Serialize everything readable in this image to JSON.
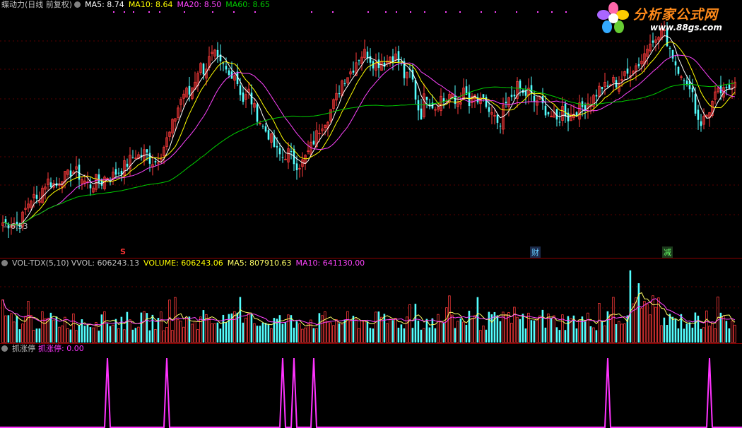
{
  "price_header": {
    "title": "蝶动力(日线 前复权)",
    "ma5": "MA5: 8.74",
    "ma10": "MA10: 8.64",
    "ma20": "MA20: 8.50",
    "ma60": "MA60: 8.65"
  },
  "price_low_label": "6.53",
  "markers": {
    "s": "S",
    "cai": "财",
    "jian": "减"
  },
  "volume_header": {
    "name": "VOL-TDX(5,10)",
    "vvol": "VVOL: 606243.13",
    "volume": "VOLUME: 606243.06",
    "ma5": "MA5: 807910.63",
    "ma10": "MA10: 641130.00"
  },
  "indicator_header": {
    "name": "抓涨停",
    "value": "抓涨停: 0.00"
  },
  "logo": {
    "text": "分析家公式网",
    "url": "www.88gs.com"
  },
  "colors": {
    "up": "#ff3b3b",
    "down": "#54ffff",
    "ma5": "#ffffff",
    "ma10": "#ffff00",
    "ma20": "#ff44ff",
    "ma60": "#00cc00",
    "indicator": "#ff33ff",
    "volume_ma5": "#ffff66",
    "volume_ma10": "#ff44ff"
  },
  "chart_data": {
    "type": "candlestick",
    "ylim": [
      6.4,
      10.6
    ],
    "closes": [
      6.6,
      6.58,
      6.62,
      6.55,
      6.7,
      6.95,
      7.1,
      7.0,
      7.25,
      7.4,
      7.35,
      7.3,
      7.5,
      7.45,
      7.6,
      7.55,
      7.45,
      7.35,
      7.3,
      7.4,
      7.35,
      7.5,
      7.45,
      7.55,
      7.6,
      7.7,
      7.8,
      7.9,
      7.85,
      7.95,
      7.8,
      7.75,
      7.9,
      8.1,
      8.3,
      8.6,
      8.9,
      9.1,
      9.05,
      9.3,
      9.6,
      9.5,
      9.7,
      9.8,
      9.6,
      9.55,
      9.4,
      9.5,
      9.2,
      8.9,
      9.1,
      8.8,
      8.6,
      8.4,
      8.3,
      8.1,
      7.9,
      7.85,
      7.95,
      7.8,
      7.7,
      7.75,
      7.9,
      8.1,
      8.3,
      8.5,
      8.6,
      8.8,
      9.0,
      9.3,
      9.4,
      9.5,
      9.7,
      9.8,
      9.85,
      9.7,
      9.6,
      9.7,
      9.65,
      9.8,
      9.75,
      9.6,
      9.3,
      9.5,
      9.0,
      8.6,
      9.1,
      8.9,
      8.8,
      9.0,
      8.9,
      9.05,
      8.85,
      8.95,
      9.1,
      8.8,
      9.0,
      8.85,
      8.9,
      8.7,
      8.6,
      8.3,
      8.8,
      8.9,
      9.1,
      9.2,
      9.0,
      9.1,
      8.9,
      8.95,
      8.8,
      8.7,
      8.6,
      8.5,
      8.8,
      8.6,
      8.7,
      8.75,
      8.8,
      8.9,
      8.95,
      9.1,
      9.2,
      9.15,
      9.3,
      9.25,
      9.35,
      9.4,
      9.55,
      9.6,
      9.7,
      9.9,
      10.2,
      10.0,
      10.3,
      10.1,
      9.9,
      9.6,
      9.5,
      9.1,
      9.3,
      8.7,
      8.5,
      8.6,
      8.8,
      9.0,
      9.1,
      9.05,
      9.2,
      9.35
    ],
    "volume_ylim": [
      0,
      1900000
    ],
    "indicator_spikes": [
      37,
      58,
      99,
      103,
      110,
      214,
      250
    ]
  }
}
